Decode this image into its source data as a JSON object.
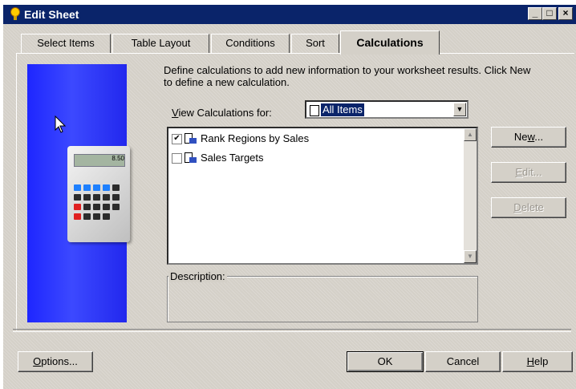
{
  "window": {
    "title": "Edit Sheet"
  },
  "tabs": [
    {
      "label": "Select Items"
    },
    {
      "label": "Table Layout"
    },
    {
      "label": "Conditions"
    },
    {
      "label": "Sort"
    },
    {
      "label": "Calculations"
    }
  ],
  "instructions": "Define calculations to add new information to your worksheet results. Click New to define a new calculation.",
  "view_calculations": {
    "label_underlined": "V",
    "label_rest": "iew Calculations for:",
    "selected": "All Items"
  },
  "calculations": [
    {
      "label": "Rank Regions by Sales",
      "checked": true
    },
    {
      "label": "Sales Targets",
      "checked": false
    }
  ],
  "description_label": "Description:",
  "side_buttons": {
    "new": {
      "pre": "Ne",
      "underline": "w",
      "post": "..."
    },
    "edit": {
      "underline": "E",
      "post": "dit..."
    },
    "delete": {
      "underline": "D",
      "post": "elete"
    }
  },
  "footer_buttons": {
    "options": {
      "underline": "O",
      "post": "ptions..."
    },
    "ok": "OK",
    "cancel": "Cancel",
    "help": {
      "underline": "H",
      "post": "elp"
    }
  },
  "calculator_display": "8.50",
  "colors": {
    "titlebar": "#0a246a",
    "sidebar": "#2a34ff",
    "dialog": "#d4d0c8"
  }
}
